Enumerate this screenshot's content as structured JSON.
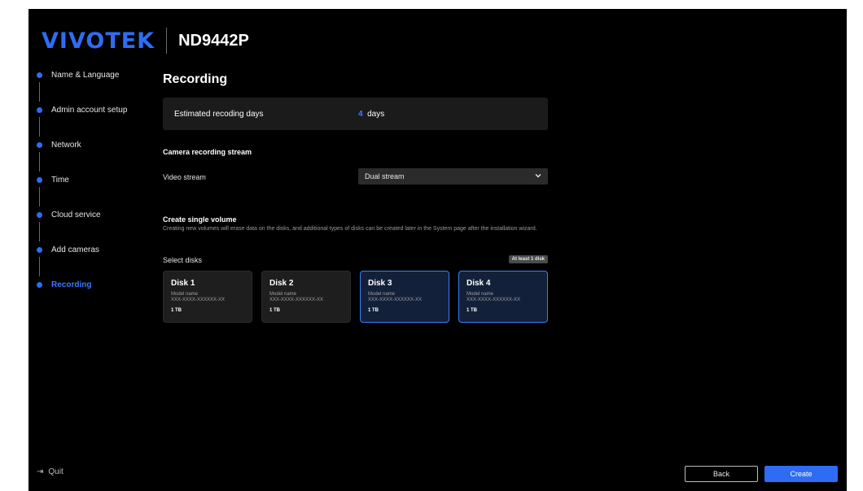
{
  "header": {
    "brand": "VIVOTEK",
    "model": "ND9442P"
  },
  "steps": [
    {
      "label": "Name & Language",
      "active": false
    },
    {
      "label": "Admin account setup",
      "active": false
    },
    {
      "label": "Network",
      "active": false
    },
    {
      "label": "Time",
      "active": false
    },
    {
      "label": "Cloud service",
      "active": false
    },
    {
      "label": "Add cameras",
      "active": false
    },
    {
      "label": "Recording",
      "active": true
    }
  ],
  "quit": {
    "label": "Quit",
    "icon": "exit-arrow-icon"
  },
  "main": {
    "title": "Recording",
    "estimate": {
      "label": "Estimated recoding days",
      "value": "4",
      "unit": "days"
    },
    "stream_section_title": "Camera recording stream",
    "video_stream": {
      "label": "Video stream",
      "value": "Dual stream"
    },
    "volume_section_title": "Create single volume",
    "volume_description": "Creating new volumes will erase data on the disks, and additional types of disks can be created later in the System page after the installation wizard.",
    "select_disks_label": "Select disks",
    "select_badge": "At least 1 disk",
    "disks": [
      {
        "name": "Disk 1",
        "model_label": "Model name",
        "model_value": "XXX-XXXX-XXXXXX-XX",
        "size": "1 TB",
        "selected": false
      },
      {
        "name": "Disk 2",
        "model_label": "Model name",
        "model_value": "XXX-XXXX-XXXXXX-XX",
        "size": "1 TB",
        "selected": false
      },
      {
        "name": "Disk 3",
        "model_label": "Model name",
        "model_value": "XXX-XXXX-XXXXXX-XX",
        "size": "1 TB",
        "selected": true
      },
      {
        "name": "Disk 4",
        "model_label": "Model name",
        "model_value": "XXX-XXXX-XXXXXX-XX",
        "size": "1 TB",
        "selected": true
      }
    ]
  },
  "footer": {
    "back_label": "Back",
    "create_label": "Create"
  },
  "colors": {
    "accent": "#2f6cf4",
    "background": "#000000",
    "card": "#1b1b1b",
    "selected_card": "#12203a"
  }
}
